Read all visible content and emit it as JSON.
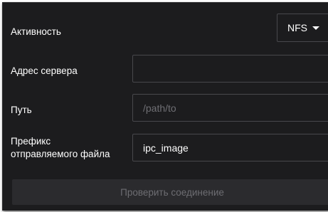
{
  "activity": {
    "label": "Активность",
    "selected": "NFS"
  },
  "server": {
    "label": "Адрес сервера",
    "value": "",
    "placeholder": ""
  },
  "path": {
    "label": "Путь",
    "value": "",
    "placeholder": "/path/to"
  },
  "prefix": {
    "label_line1": "Префикс",
    "label_line2": "отправляемого файла",
    "value": "ipc_image"
  },
  "check_button": {
    "label": "Проверить соединение"
  }
}
